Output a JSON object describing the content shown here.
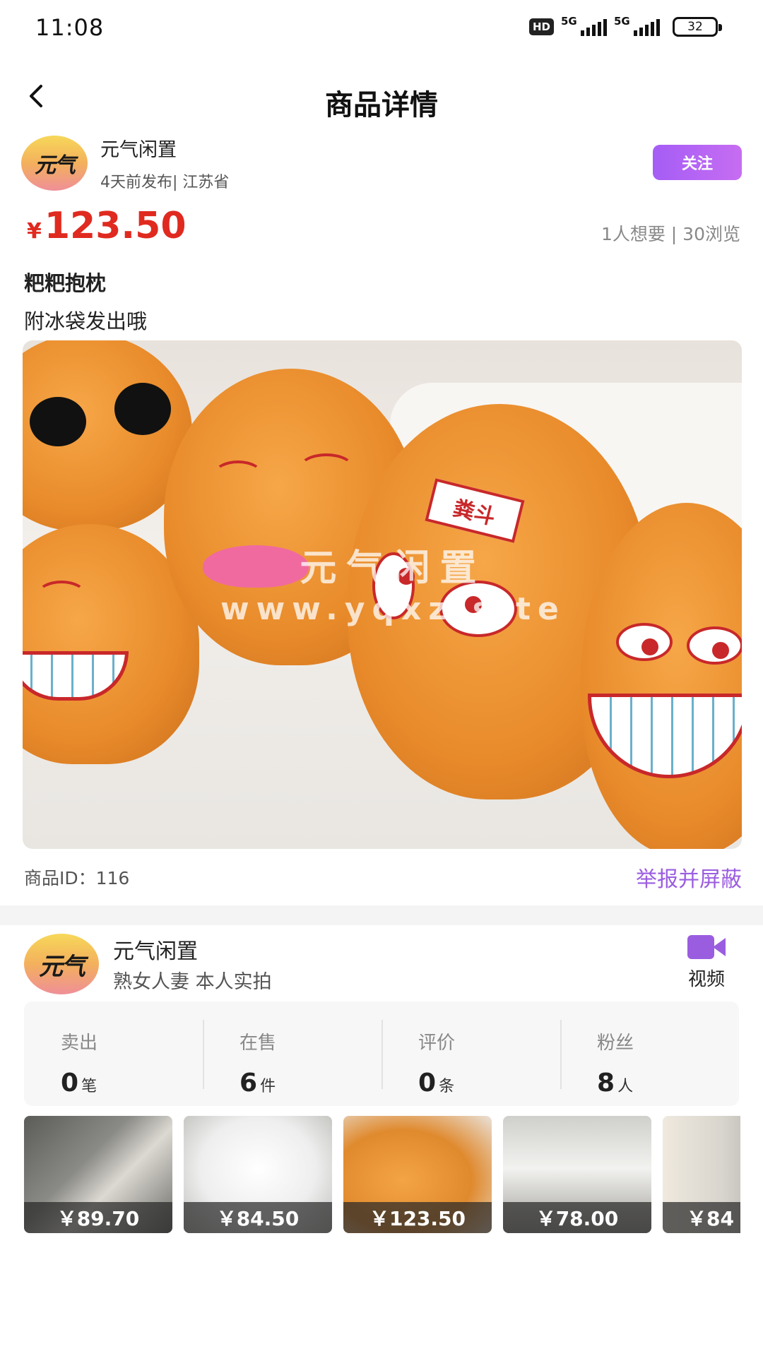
{
  "status_bar": {
    "time": "11:08",
    "hd": "HD",
    "net1": "5G",
    "net2": "5G",
    "battery": "32"
  },
  "nav": {
    "title": "商品详情",
    "back_icon": "chevron-left-icon"
  },
  "seller": {
    "avatar_text": "元气",
    "name": "元气闲置",
    "meta": "4天前发布| 江苏省",
    "follow_label": "关注"
  },
  "product": {
    "currency": "¥",
    "price": "123.50",
    "stats": "1人想要 | 30浏览",
    "title": "粑粑抱枕",
    "description": "附冰袋发出哦",
    "image_tag": "粪斗",
    "watermark_line1": "元气闲置",
    "watermark_line2": "www.yqxz.site",
    "id_text": "商品ID：116",
    "report_label": "举报并屏蔽"
  },
  "shop": {
    "avatar_text": "元气",
    "name": "元气闲置",
    "description": "熟女人妻 本人实拍",
    "video_label": "视频",
    "stats": [
      {
        "label": "卖出",
        "value": "0",
        "unit": "笔"
      },
      {
        "label": "在售",
        "value": "6",
        "unit": "件"
      },
      {
        "label": "评价",
        "value": "0",
        "unit": "条"
      },
      {
        "label": "粉丝",
        "value": "8",
        "unit": "人"
      }
    ],
    "items": [
      {
        "price": "￥89.70"
      },
      {
        "price": "￥84.50"
      },
      {
        "price": "￥123.50"
      },
      {
        "price": "￥78.00"
      },
      {
        "price": "￥84"
      }
    ]
  },
  "colors": {
    "price_red": "#e02a1f",
    "accent_purple": "#9b5de0",
    "follow_gradient_start": "#a55df5",
    "follow_gradient_end": "#c66df2"
  }
}
